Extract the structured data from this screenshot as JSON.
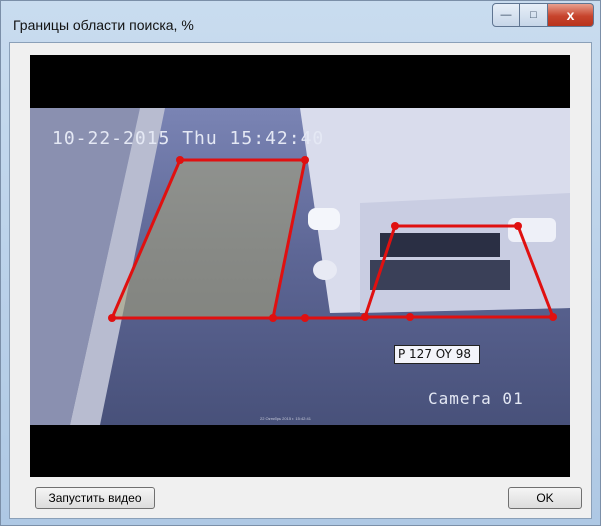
{
  "window": {
    "title": "Границы области поиска, %",
    "controls": {
      "minimize_label": "—",
      "maximize_label": "□",
      "close_label": "x"
    }
  },
  "video": {
    "timestamp": "10-22-2015 Thu 15:42:40",
    "camera_label": "Camera 01",
    "footer_caption": "22 Октябрь 2015 г. 15:42:41",
    "plate_text": "P 127 OY 98"
  },
  "search_zones": {
    "line_color": "#e01010"
  },
  "buttons": {
    "start_video_label": "Запустить видео",
    "ok_label": "OK"
  }
}
